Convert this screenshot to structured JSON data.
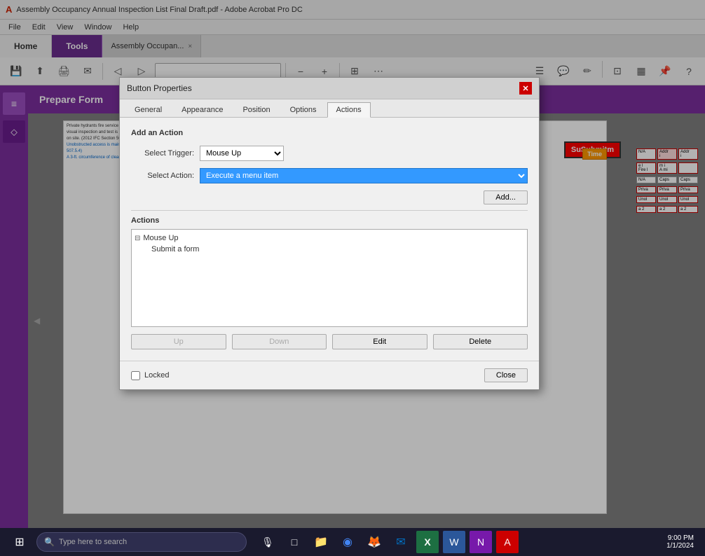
{
  "window": {
    "title": "Assembly Occupancy Annual Inspection List Final Draft.pdf - Adobe Acrobat Pro DC"
  },
  "menubar": {
    "items": [
      "File",
      "Edit",
      "View",
      "Window",
      "Help"
    ]
  },
  "tabs": {
    "home": "Home",
    "tools": "Tools",
    "doc_tab": "Assembly Occupan...",
    "doc_close": "×"
  },
  "toolbar": {
    "search_placeholder": ""
  },
  "prepare_form": {
    "label": "Prepare Form"
  },
  "dialog": {
    "title": "Button Properties",
    "tabs": [
      "General",
      "Appearance",
      "Position",
      "Options",
      "Actions"
    ],
    "active_tab": "Actions",
    "add_action_section": "Add an Action",
    "select_trigger_label": "Select Trigger:",
    "select_trigger_value": "Mouse Up",
    "select_action_label": "Select Action:",
    "select_action_value": "Execute a menu item",
    "add_btn": "Add...",
    "actions_section": "Actions",
    "tree_parent": "Mouse Up",
    "tree_child": "Submit a form",
    "up_btn": "Up",
    "down_btn": "Down",
    "edit_btn": "Edit",
    "delete_btn": "Delete",
    "locked_label": "Locked",
    "close_btn": "Close",
    "close_x": "✕"
  },
  "pdf_content": {
    "lines": [
      "Private hydrants fire service mains and water tanks: annual",
      "visual inspection and test is maintained and with records kept",
      "on site. (2012 IFC Section 507.5.3)",
      "Unobstructed access is maintained at all times. (2012 IFC Section",
      "507.5.4)",
      "A 3-ft. circumference of clearance of clear space is maintained at all"
    ],
    "right_fields": [
      "Priva",
      "Priva",
      "Priva",
      "Unol",
      "Unol",
      "Unol",
      "a 2",
      "a 2",
      "a 2"
    ]
  },
  "submit_btn": {
    "label": "SuSubmitm"
  },
  "time_field": {
    "label": "Time"
  },
  "taskbar": {
    "search_placeholder": "Type here to search",
    "apps": [
      "⊞",
      "🔍",
      "□",
      "📁",
      "◉",
      "🦊",
      "✉",
      "X",
      "W",
      "N",
      "🅰"
    ]
  },
  "right_panel_fields": [
    {
      "label": "N/A",
      "type": "gray"
    },
    {
      "label": "Addr",
      "type": "normal"
    },
    {
      "label": "Fire l",
      "type": "normal"
    },
    {
      "label": "A mi",
      "type": "normal"
    },
    {
      "label": "N/A",
      "type": "gray"
    },
    {
      "label": "Caps",
      "type": "normal"
    }
  ]
}
